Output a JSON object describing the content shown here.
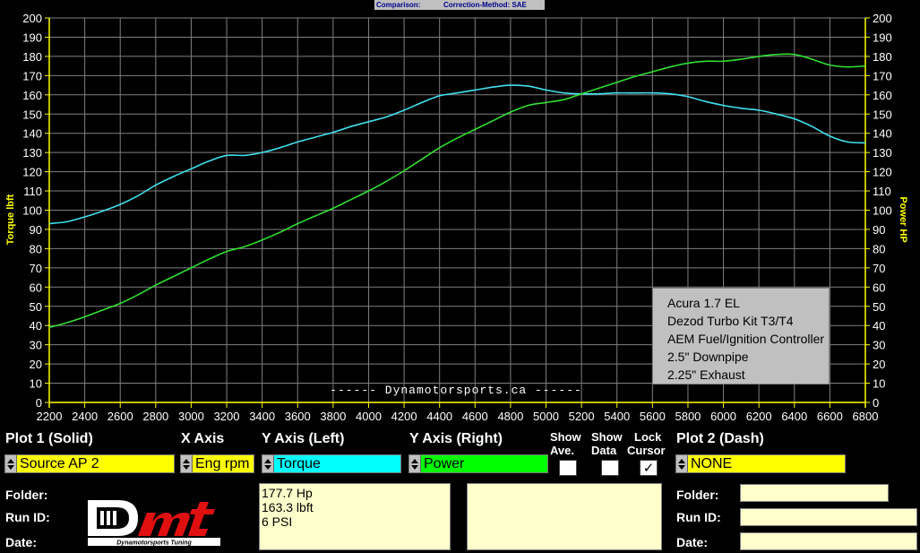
{
  "header": {
    "comparison_label": "Comparison:",
    "correction_label": "Correction-Method: SAE"
  },
  "colors": {
    "torque": "#40e0f0",
    "power": "#30e030",
    "plot_bg": "#000000",
    "grid": "#808080",
    "yellow": "#ffff00"
  },
  "chart_data": {
    "type": "line",
    "xlabel": "",
    "ylabel_left": "Torque lbft",
    "ylabel_right": "Power HP",
    "xlim": [
      2200,
      6800
    ],
    "ylim": [
      0,
      200
    ],
    "x_ticks": [
      2200,
      2400,
      2600,
      2800,
      3000,
      3200,
      3400,
      3600,
      3800,
      4000,
      4200,
      4400,
      4600,
      4800,
      5000,
      5200,
      5400,
      5600,
      5800,
      6000,
      6200,
      6400,
      6600,
      6800
    ],
    "y_ticks": [
      0,
      10,
      20,
      30,
      40,
      50,
      60,
      70,
      80,
      90,
      100,
      110,
      120,
      130,
      140,
      150,
      160,
      170,
      180,
      190,
      200
    ],
    "grid": true,
    "series": [
      {
        "name": "Torque",
        "style": "solid",
        "color": "#40e0f0",
        "x": [
          2200,
          2300,
          2400,
          2500,
          2600,
          2700,
          2800,
          2900,
          3000,
          3100,
          3200,
          3300,
          3400,
          3500,
          3600,
          3700,
          3800,
          3900,
          4000,
          4100,
          4200,
          4300,
          4400,
          4500,
          4600,
          4700,
          4800,
          4900,
          5000,
          5100,
          5200,
          5300,
          5400,
          5500,
          5600,
          5700,
          5800,
          5900,
          6000,
          6100,
          6200,
          6300,
          6400,
          6500,
          6600,
          6700,
          6800
        ],
        "y": [
          93,
          94,
          96.5,
          99.5,
          103,
          107.5,
          113,
          117.5,
          121.5,
          125.5,
          128.5,
          128.5,
          130,
          132.5,
          135.5,
          138,
          140.5,
          143.5,
          146,
          148.5,
          152,
          156,
          159.5,
          161,
          162.5,
          164,
          165,
          164.5,
          162.5,
          161,
          160.5,
          160.5,
          161,
          161,
          161,
          160.5,
          159,
          156.5,
          154.5,
          153,
          152,
          150,
          147.5,
          143.5,
          138.5,
          135.5,
          135
        ]
      },
      {
        "name": "Power",
        "style": "solid",
        "color": "#30e030",
        "x": [
          2200,
          2300,
          2400,
          2500,
          2600,
          2700,
          2800,
          2900,
          3000,
          3100,
          3200,
          3300,
          3400,
          3500,
          3600,
          3700,
          3800,
          3900,
          4000,
          4100,
          4200,
          4300,
          4400,
          4500,
          4600,
          4700,
          4800,
          4900,
          5000,
          5100,
          5200,
          5300,
          5400,
          5500,
          5600,
          5700,
          5800,
          5900,
          6000,
          6100,
          6200,
          6300,
          6400,
          6500,
          6600,
          6700,
          6800
        ],
        "y": [
          39,
          41.5,
          44.5,
          48,
          51.5,
          56,
          61,
          65.5,
          70,
          74.5,
          78.5,
          81,
          84.5,
          88.5,
          93,
          97,
          101,
          105.5,
          110,
          115,
          120.5,
          126.5,
          132.5,
          137.5,
          142,
          146.5,
          151,
          154.5,
          156,
          157.5,
          160.5,
          163.5,
          166.5,
          169.5,
          172,
          174.5,
          176.5,
          177.5,
          177.5,
          178.5,
          180,
          181,
          181,
          178.5,
          175.5,
          174.5,
          175
        ]
      }
    ],
    "annotation_lines": [
      "Acura 1.7 EL",
      "Dezod Turbo Kit T3/T4",
      "AEM Fuel/Ignition Controller",
      "2.5\" Downpipe",
      "2.25\" Exhaust"
    ],
    "watermark": "------ Dynamotorsports.ca ------"
  },
  "controls": {
    "plot1_label": "Plot 1 (Solid)",
    "xaxis_label": "X Axis",
    "yleft_label": "Y Axis (Left)",
    "yright_label": "Y Axis (Right)",
    "show_ave_label_1": "Show",
    "show_ave_label_2": "Ave.",
    "show_data_label_1": "Show",
    "show_data_label_2": "Data",
    "lock_cursor_label_1": "Lock",
    "lock_cursor_label_2": "Cursor",
    "plot2_label": "Plot 2 (Dash)",
    "plot1_value": "Source AP 2",
    "xaxis_value": "Eng rpm",
    "yleft_value": "Torque",
    "yright_value": "Power",
    "plot2_value": "NONE",
    "show_ave_checked": false,
    "show_data_checked": false,
    "lock_cursor_checked": true,
    "check_mark": "✓",
    "folder_label": "Folder:",
    "runid_label": "Run ID:",
    "date_label": "Date:",
    "result_lines": [
      "177.7 Hp",
      "163.3 lbft",
      "6 PSI"
    ],
    "logo_text": "Dmt",
    "logo_tagline": "Dynamotorsports Tuning"
  }
}
